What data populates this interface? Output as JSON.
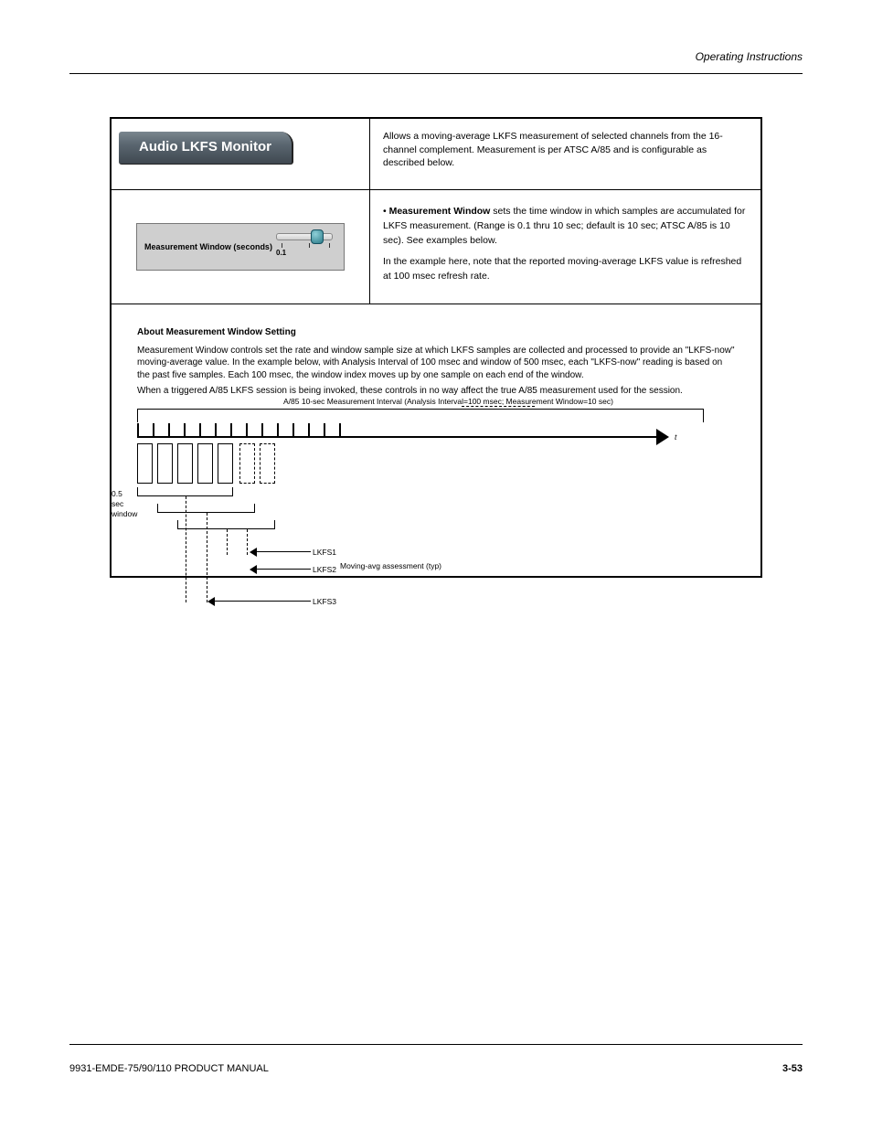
{
  "header": {
    "right": "Operating Instructions"
  },
  "table": {
    "row1": {
      "title": "Audio LKFS Monitor",
      "desc": "Allows a moving-average LKFS measurement of selected channels from the 16-channel complement. Measurement is per ATSC A/85 and is configurable as described below."
    },
    "row2": {
      "slider_label": "Measurement Window (seconds)",
      "slider_value": "0.1",
      "desc_bold": "Measurement Window",
      "desc_rest": " sets the time window in which samples are accumulated for LKFS measurement. (Range is 0.1 thru 10 sec; default is 10 sec; ATSC A/85 is 10 sec). See examples below.",
      "desc_note": "In the example here, note that the reported moving-average LKFS value is refreshed at 100 msec refresh rate."
    },
    "row3": {
      "heading": "About Measurement Window Setting",
      "p1": "Measurement Window controls set the rate and window sample size at which LKFS samples are collected and processed to provide an \"LKFS-now\" moving-average value. In the example below, with Analysis Interval of 100 msec and window of 500 msec, each \"LKFS-now\" reading is based on the past five samples. Each 100 msec, the window index moves up by one sample on each end of the window.",
      "p2": "When a triggered A/85 LKFS session is being invoked, these controls in no way affect the true A/85 measurement used for the session."
    }
  },
  "diagram": {
    "top_label": "A/85 10-sec Measurement Interval (Analysis Interval=100 msec; Measurement Window=10 sec)",
    "t_label": "t",
    "bracket_label": "0.5",
    "bracket_unit": "sec",
    "bracket_suffix": "window",
    "lkfs1": "LKFS1",
    "lkfs2": "LKFS2",
    "lkfs3": "LKFS3",
    "assessment_label": "Moving-avg assessment (typ)"
  },
  "footer": {
    "left": "9931-EMDE-75/90/110 PRODUCT MANUAL",
    "right": "3-53"
  }
}
